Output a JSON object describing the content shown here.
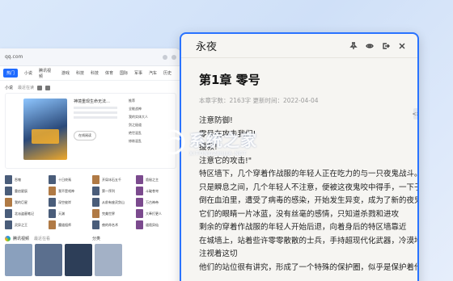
{
  "browser": {
    "url": "qq.com",
    "nav_tabs": [
      "热门",
      "小说",
      "腾讯视频",
      "游戏",
      "科技",
      "科技",
      "体育",
      "国际",
      "军事",
      "汽车",
      "历史"
    ],
    "novel_section": {
      "title": "小说",
      "subtitle": "最近在读"
    },
    "featured": {
      "title": "神境重现生命无法…",
      "read_button": "在线阅读",
      "recommend_label": "推荐",
      "recommend_items": [
        "全能战神",
        "我的实体大人",
        "剑之极道",
        "绝世混乱",
        "修炼混乱"
      ]
    },
    "grid_items": [
      "吞噬",
      "十日终焉",
      "开局冰石五千",
      "诡秘之主",
      "重启星辰",
      "我不是戏神",
      "第一序列",
      "斗破苍穹",
      "我的巨星",
      "深空彼岸",
      "从前有座灵剑山",
      "万古神帝",
      "北派盗墓笔记",
      "天渊",
      "完美世界",
      "大奉打更人",
      "灵异之王",
      "魔道祖师",
      "夜的命名术",
      "道诡异仙"
    ],
    "video_section": {
      "title": "腾讯视频",
      "subtitle": "最近在看"
    },
    "category_label": "分类"
  },
  "reader": {
    "book_title": "永夜",
    "chapter_title": "第1章 零号",
    "meta": "本章字数：2163字  更新时间：2022-04-04",
    "paragraphs": [
      "注意防御!",
      "零号在攻击我们!",
      "援救!",
      "注意它的攻击!\"",
      "特区墙下，几个穿着作战服的年轻人正在吃力的与一只夜鬼战斗。",
      "只是瞬息之间，几个年轻人不注意，便被这夜鬼咬中得手，一下子",
      "倒在血泊里，遭受了病毒的感染，开始发生异变，成为了新的夜鬼",
      "它们的眼睛一片冰蓝，没有丝毫的感情，只知道杀戮和进攻",
      "剩余的穿着作战服的年轻人开始后退，向着身后的特区墙靠近",
      "在城墙上，站着些许零零散散的士兵，手持超现代化武器，冷漠地",
      "注视着这切",
      "他们的站位很有讲究，形成了一个特殊的保护圈，似乎是保护着什"
    ],
    "handle_label": "<>"
  },
  "watermark": {
    "text": "系统之家",
    "subtext": "XITONGZHIJIA.NET"
  },
  "colors": {
    "accent": "#2a73ff",
    "reader_bg": "#f6f5f2",
    "desktop_bg": "#d7e6fa"
  }
}
